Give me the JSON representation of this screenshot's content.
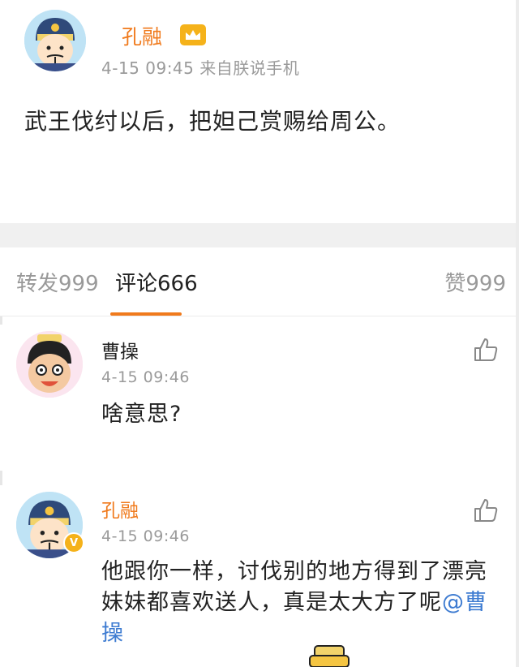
{
  "post": {
    "author": "孔融",
    "time": "4-15 09:45",
    "source": "来自朕说手机",
    "text": "武王伐纣以后，把妲己赏赐给周公。"
  },
  "tabs": {
    "repost": "转发999",
    "comments": "评论666",
    "likes": "赞999"
  },
  "comments": [
    {
      "author": "曹操",
      "author_color": "#222222",
      "time": "4-15 09:46",
      "text": "啥意思?"
    },
    {
      "author": "孔融",
      "author_color": "#f07a1c",
      "time": "4-15 09:46",
      "text": "他跟你一样，讨伐别的地方得到了漂亮妹妹都喜欢送人，真是太大方了呢",
      "mention": "@曹操"
    }
  ],
  "colors": {
    "accent": "#f07a1c",
    "mention": "#3d7bd1",
    "muted": "#9a9a9a"
  }
}
